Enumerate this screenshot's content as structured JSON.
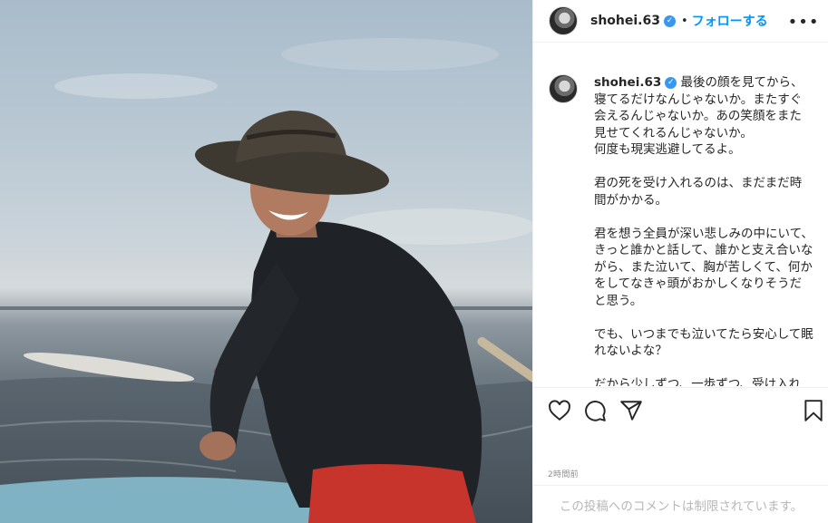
{
  "post": {
    "username": "shohei.63",
    "verified_mark": "✓",
    "separator": "•",
    "follow_label": "フォローする",
    "more_label": "•••",
    "caption": "最後の顔を見てから、寝てるだけなんじゃないか。またすぐ会えるんじゃないか。あの笑顔をまた見せてくれるんじゃないか。\n何度も現実逃避してるよ。\n\n君の死を受け入れるのは、まだまだ時間がかかる。\n\n君を想う全員が深い悲しみの中にいて、きっと誰かと話して、誰かと支え合いながら、また泣いて、胸が苦しくて、何かをしてなきゃ頭がおかしくなりそうだと思う。\n\nでも、いつまでも泣いてたら安心して眠れないよな？\n\nだから少しずつ、一歩ずつ、受け入れ",
    "timestamp": "2時間前",
    "comments_disabled_text": "この投稿へのコメントは制限されています。"
  },
  "icons": {
    "like": "heart-icon",
    "comment": "comment-icon",
    "share": "share-icon",
    "save": "bookmark-icon",
    "more": "more-options-icon"
  },
  "colors": {
    "accent": "#0095f6",
    "verified": "#3897f0",
    "muted": "#8e8e8e",
    "border": "#efefef"
  }
}
